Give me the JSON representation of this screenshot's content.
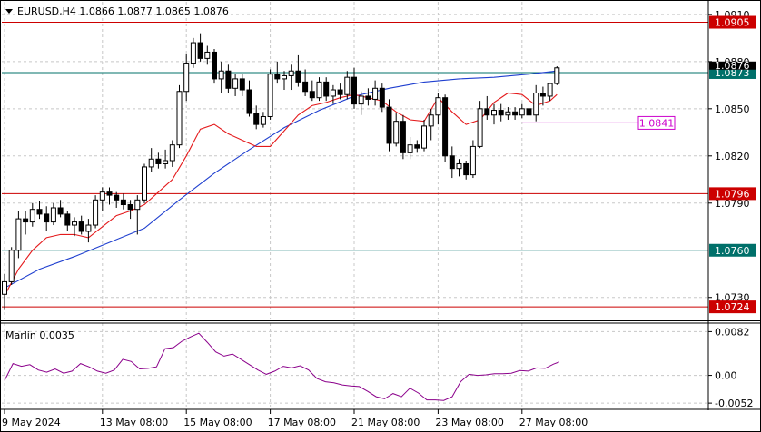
{
  "header": {
    "symbol_line": "EURUSD,H4  1.0866 1.0877 1.0865 1.0876"
  },
  "indicator": {
    "label": "Marlin 0.0035"
  },
  "colors": {
    "background": "#ffffff",
    "grid": "#c8c8c8",
    "candle": "#000000",
    "ma_fast": "#e41a1c",
    "ma_slow": "#1f3fcf",
    "resistance": "#cc0000",
    "support": "#00706a",
    "marlin": "#8b008b",
    "target": "#cc00cc"
  },
  "chart_data": [
    {
      "type": "candlestick",
      "symbol": "EURUSD",
      "timeframe": "H4",
      "ylim": [
        1.0716,
        1.0918
      ],
      "y_ticks": [
        "1.0910",
        "1.0880",
        "1.0850",
        "1.0820",
        "1.0790",
        "1.0730"
      ],
      "x_tick_labels": [
        "9 May 2024",
        "13 May 08:00",
        "15 May 08:00",
        "17 May 08:00",
        "21 May 08:00",
        "23 May 08:00",
        "27 May 08:00"
      ],
      "x_tick_candle_index": [
        0,
        14,
        26,
        38,
        50,
        62,
        74
      ],
      "candles": [
        [
          1.0732,
          1.0745,
          1.0722,
          1.074
        ],
        [
          1.074,
          1.0762,
          1.0738,
          1.076
        ],
        [
          1.076,
          1.0785,
          1.0755,
          1.078
        ],
        [
          1.078,
          1.0785,
          1.077,
          1.0778
        ],
        [
          1.0778,
          1.079,
          1.0775,
          1.0786
        ],
        [
          1.0786,
          1.0791,
          1.078,
          1.0783
        ],
        [
          1.0783,
          1.0788,
          1.0772,
          1.0778
        ],
        [
          1.0778,
          1.079,
          1.0776,
          1.0787
        ],
        [
          1.0787,
          1.0792,
          1.0781,
          1.0783
        ],
        [
          1.0783,
          1.0785,
          1.0772,
          1.0776
        ],
        [
          1.0776,
          1.0781,
          1.0769,
          1.0778
        ],
        [
          1.0778,
          1.0782,
          1.077,
          1.0772
        ],
        [
          1.0772,
          1.078,
          1.0765,
          1.0776
        ],
        [
          1.0776,
          1.0795,
          1.0774,
          1.0792
        ],
        [
          1.0792,
          1.08,
          1.0785,
          1.0797
        ],
        [
          1.0797,
          1.08,
          1.0789,
          1.0795
        ],
        [
          1.0795,
          1.0797,
          1.0787,
          1.0792
        ],
        [
          1.0792,
          1.0796,
          1.0786,
          1.0789
        ],
        [
          1.0789,
          1.0792,
          1.078,
          1.0786
        ],
        [
          1.0786,
          1.0795,
          1.077,
          1.0792
        ],
        [
          1.0792,
          1.0815,
          1.079,
          1.0813
        ],
        [
          1.0813,
          1.0825,
          1.081,
          1.0818
        ],
        [
          1.0818,
          1.0822,
          1.0812,
          1.0815
        ],
        [
          1.0815,
          1.0824,
          1.0812,
          1.0817
        ],
        [
          1.0817,
          1.083,
          1.0813,
          1.0827
        ],
        [
          1.0827,
          1.0865,
          1.0825,
          1.0861
        ],
        [
          1.0861,
          1.0885,
          1.0855,
          1.0879
        ],
        [
          1.0879,
          1.0895,
          1.0876,
          1.0892
        ],
        [
          1.0892,
          1.0898,
          1.088,
          1.0882
        ],
        [
          1.0882,
          1.089,
          1.0878,
          1.0886
        ],
        [
          1.0886,
          1.0888,
          1.0866,
          1.0869
        ],
        [
          1.0869,
          1.088,
          1.086,
          1.0874
        ],
        [
          1.0874,
          1.0878,
          1.086,
          1.0863
        ],
        [
          1.0863,
          1.0872,
          1.0858,
          1.0869
        ],
        [
          1.0869,
          1.0872,
          1.0858,
          1.0862
        ],
        [
          1.0862,
          1.0868,
          1.0845,
          1.0847
        ],
        [
          1.0847,
          1.0852,
          1.0837,
          1.084
        ],
        [
          1.084,
          1.0848,
          1.0838,
          1.0845
        ],
        [
          1.0845,
          1.0875,
          1.0843,
          1.0872
        ],
        [
          1.0872,
          1.088,
          1.0866,
          1.0869
        ],
        [
          1.0869,
          1.0874,
          1.0862,
          1.0871
        ],
        [
          1.0871,
          1.0878,
          1.0862,
          1.0874
        ],
        [
          1.0874,
          1.0884,
          1.0864,
          1.0867
        ],
        [
          1.0867,
          1.0875,
          1.0858,
          1.0861
        ],
        [
          1.0861,
          1.0868,
          1.0855,
          1.0857
        ],
        [
          1.0857,
          1.087,
          1.0855,
          1.0867
        ],
        [
          1.0867,
          1.087,
          1.0855,
          1.0858
        ],
        [
          1.0858,
          1.0865,
          1.0853,
          1.0862
        ],
        [
          1.0862,
          1.0866,
          1.0856,
          1.0859
        ],
        [
          1.0859,
          1.0874,
          1.0856,
          1.087
        ],
        [
          1.087,
          1.0876,
          1.085,
          1.0853
        ],
        [
          1.0853,
          1.0861,
          1.0846,
          1.0858
        ],
        [
          1.0858,
          1.0863,
          1.0852,
          1.0856
        ],
        [
          1.0856,
          1.0868,
          1.0852,
          1.0863
        ],
        [
          1.0863,
          1.0866,
          1.0848,
          1.0851
        ],
        [
          1.0851,
          1.0856,
          1.0823,
          1.0828
        ],
        [
          1.0828,
          1.0847,
          1.0826,
          1.0842
        ],
        [
          1.0842,
          1.0846,
          1.0818,
          1.0822
        ],
        [
          1.0822,
          1.0832,
          1.0818,
          1.0827
        ],
        [
          1.0827,
          1.083,
          1.0822,
          1.0825
        ],
        [
          1.0825,
          1.0843,
          1.0823,
          1.0839
        ],
        [
          1.0839,
          1.085,
          1.083,
          1.0846
        ],
        [
          1.0846,
          1.086,
          1.084,
          1.0857
        ],
        [
          1.0857,
          1.0859,
          1.0816,
          1.082
        ],
        [
          1.082,
          1.0826,
          1.0806,
          1.0812
        ],
        [
          1.0812,
          1.0818,
          1.0807,
          1.0815
        ],
        [
          1.0815,
          1.0817,
          1.0805,
          1.0808
        ],
        [
          1.0808,
          1.083,
          1.0806,
          1.0826
        ],
        [
          1.0826,
          1.0855,
          1.0825,
          1.085
        ],
        [
          1.085,
          1.0858,
          1.0843,
          1.0846
        ],
        [
          1.0846,
          1.0853,
          1.084,
          1.0849
        ],
        [
          1.0849,
          1.0853,
          1.0842,
          1.0846
        ],
        [
          1.0846,
          1.0851,
          1.0843,
          1.0848
        ],
        [
          1.0848,
          1.0851,
          1.0843,
          1.0846
        ],
        [
          1.0846,
          1.0853,
          1.0844,
          1.085
        ],
        [
          1.085,
          1.0855,
          1.084,
          1.0846
        ],
        [
          1.0846,
          1.0865,
          1.0842,
          1.086
        ],
        [
          1.086,
          1.0864,
          1.0852,
          1.0858
        ],
        [
          1.0858,
          1.0866,
          1.0855,
          1.0866
        ],
        [
          1.0866,
          1.0877,
          1.0865,
          1.0876
        ]
      ],
      "ma_fast": [
        [
          0,
          1.0731
        ],
        [
          2,
          1.0748
        ],
        [
          4,
          1.076
        ],
        [
          6,
          1.0768
        ],
        [
          8,
          1.077
        ],
        [
          10,
          1.077
        ],
        [
          12,
          1.0768
        ],
        [
          14,
          1.0775
        ],
        [
          16,
          1.0782
        ],
        [
          18,
          1.0785
        ],
        [
          20,
          1.0789
        ],
        [
          22,
          1.0797
        ],
        [
          24,
          1.0805
        ],
        [
          26,
          1.082
        ],
        [
          28,
          1.0837
        ],
        [
          30,
          1.084
        ],
        [
          32,
          1.0834
        ],
        [
          34,
          1.083
        ],
        [
          36,
          1.0826
        ],
        [
          38,
          1.0826
        ],
        [
          40,
          1.0836
        ],
        [
          42,
          1.0846
        ],
        [
          44,
          1.0852
        ],
        [
          46,
          1.0854
        ],
        [
          48,
          1.0857
        ],
        [
          50,
          1.0859
        ],
        [
          52,
          1.0857
        ],
        [
          54,
          1.0855
        ],
        [
          56,
          1.0848
        ],
        [
          58,
          1.0843
        ],
        [
          60,
          1.0842
        ],
        [
          62,
          1.0857
        ],
        [
          64,
          1.0848
        ],
        [
          66,
          1.084
        ],
        [
          68,
          1.0843
        ],
        [
          70,
          1.0854
        ],
        [
          72,
          1.086
        ],
        [
          74,
          1.0859
        ],
        [
          76,
          1.0852
        ],
        [
          78,
          1.0855
        ],
        [
          79,
          1.0859
        ]
      ],
      "ma_slow": [
        [
          0,
          1.0736
        ],
        [
          5,
          1.0748
        ],
        [
          10,
          1.0756
        ],
        [
          15,
          1.0765
        ],
        [
          20,
          1.0774
        ],
        [
          25,
          1.0792
        ],
        [
          30,
          1.0809
        ],
        [
          35,
          1.0824
        ],
        [
          40,
          1.0838
        ],
        [
          45,
          1.0849
        ],
        [
          50,
          1.0858
        ],
        [
          55,
          1.0863
        ],
        [
          60,
          1.0867
        ],
        [
          65,
          1.0869
        ],
        [
          70,
          1.087
        ],
        [
          75,
          1.0872
        ],
        [
          79,
          1.0874
        ]
      ],
      "levels": [
        {
          "name": "1.0905",
          "value": 1.0905,
          "kind": "resistance"
        },
        {
          "name": "1.0873",
          "value": 1.0873,
          "kind": "support"
        },
        {
          "name": "1.0796",
          "value": 1.0796,
          "kind": "resistance"
        },
        {
          "name": "1.0760",
          "value": 1.076,
          "kind": "support"
        },
        {
          "name": "1.0724",
          "value": 1.0724,
          "kind": "resistance"
        }
      ],
      "current_price": "1.0876",
      "target": {
        "label": "1.0841",
        "value": 1.0841,
        "from_index": 74,
        "to_index": 90
      }
    },
    {
      "type": "line",
      "name": "Marlin",
      "ylim": [
        -0.0062,
        0.0098
      ],
      "y_ticks": [
        "0.0082",
        "0.00",
        "-0.0052"
      ],
      "values": [
        [
          0,
          -0.001
        ],
        [
          3,
          0.0022
        ],
        [
          6,
          0.0017
        ],
        [
          9,
          0.002
        ],
        [
          12,
          0.001
        ],
        [
          15,
          0.0006
        ],
        [
          18,
          0.0012
        ],
        [
          21,
          0.0004
        ],
        [
          24,
          0.0008
        ],
        [
          27,
          0.0022
        ],
        [
          30,
          0.0016
        ],
        [
          33,
          0.0008
        ],
        [
          36,
          0.0004
        ],
        [
          39,
          0.001
        ],
        [
          42,
          0.003
        ],
        [
          45,
          0.0026
        ],
        [
          48,
          0.0012
        ],
        [
          51,
          0.0013
        ],
        [
          54,
          0.0016
        ],
        [
          57,
          0.005
        ],
        [
          60,
          0.0052
        ],
        [
          63,
          0.0064
        ],
        [
          66,
          0.0072
        ],
        [
          69,
          0.0079
        ],
        [
          72,
          0.0062
        ],
        [
          75,
          0.0044
        ],
        [
          78,
          0.0036
        ],
        [
          81,
          0.004
        ],
        [
          84,
          0.003
        ],
        [
          87,
          0.002
        ],
        [
          90,
          0.001
        ],
        [
          93,
          0.0002
        ],
        [
          96,
          0.0008
        ],
        [
          99,
          0.0017
        ],
        [
          102,
          0.0014
        ],
        [
          105,
          0.0018
        ],
        [
          108,
          0.001
        ],
        [
          111,
          -0.0006
        ],
        [
          114,
          -0.0012
        ],
        [
          117,
          -0.0014
        ],
        [
          120,
          -0.0018
        ],
        [
          123,
          -0.002
        ],
        [
          126,
          -0.0021
        ],
        [
          129,
          -0.003
        ],
        [
          132,
          -0.004
        ],
        [
          135,
          -0.0044
        ],
        [
          138,
          -0.0034
        ],
        [
          141,
          -0.004
        ],
        [
          144,
          -0.0024
        ],
        [
          147,
          -0.0033
        ],
        [
          150,
          -0.0046
        ],
        [
          153,
          -0.0046
        ],
        [
          156,
          -0.0047
        ],
        [
          159,
          -0.004
        ],
        [
          162,
          -0.0012
        ],
        [
          165,
          0.0002
        ],
        [
          168,
          0.0
        ],
        [
          171,
          0.0001
        ],
        [
          174,
          0.0003
        ],
        [
          177,
          0.0003
        ],
        [
          180,
          0.0004
        ],
        [
          183,
          0.0009
        ],
        [
          186,
          0.0008
        ],
        [
          189,
          0.0014
        ],
        [
          192,
          0.0013
        ],
        [
          195,
          0.0021
        ],
        [
          197,
          0.0025
        ]
      ]
    }
  ]
}
